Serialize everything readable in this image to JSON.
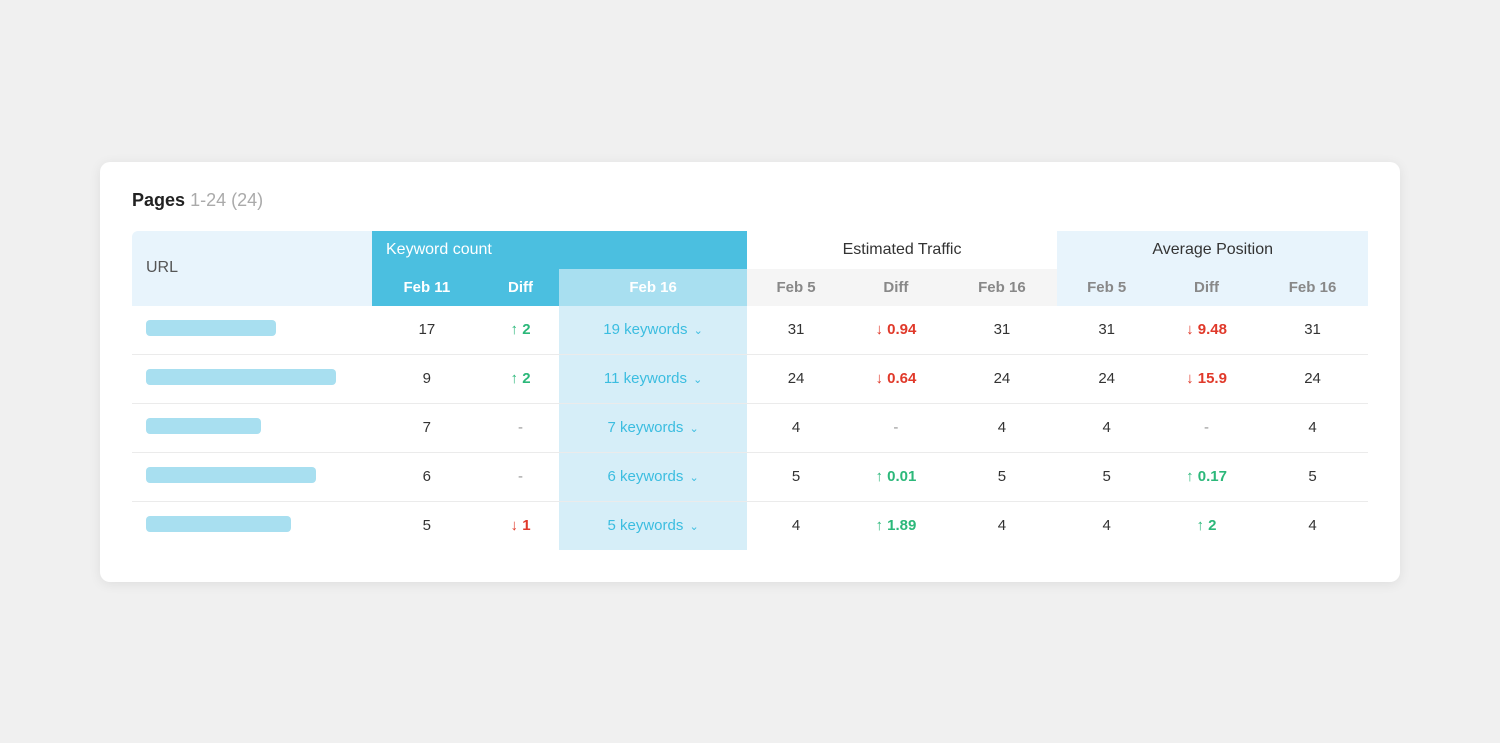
{
  "title": {
    "label": "Pages",
    "range": "1-24",
    "count": "(24)"
  },
  "columns": {
    "url": "URL",
    "keyword_count": "Keyword count",
    "estimated_traffic": "Estimated Traffic",
    "average_position": "Average Position",
    "feb11": "Feb 11",
    "diff": "Diff",
    "feb16": "Feb 16",
    "feb5_traffic": "Feb 5",
    "diff_traffic": "Diff",
    "feb16_traffic": "Feb 16",
    "feb5_position": "Feb 5",
    "diff_position": "Diff",
    "feb16_position": "Feb 16"
  },
  "rows": [
    {
      "url_width": 130,
      "kw_old": "17",
      "kw_diff_dir": "up",
      "kw_diff_val": "2",
      "kw_new": "19 keywords",
      "traffic_old": "31",
      "traffic_diff_dir": "down",
      "traffic_diff_val": "0.94",
      "traffic_new": "31",
      "pos_old": "31",
      "pos_diff_dir": "down",
      "pos_diff_val": "9.48",
      "pos_new": "31"
    },
    {
      "url_width": 190,
      "kw_old": "9",
      "kw_diff_dir": "up",
      "kw_diff_val": "2",
      "kw_new": "11 keywords",
      "traffic_old": "24",
      "traffic_diff_dir": "down",
      "traffic_diff_val": "0.64",
      "traffic_new": "24",
      "pos_old": "24",
      "pos_diff_dir": "down",
      "pos_diff_val": "15.9",
      "pos_new": "24"
    },
    {
      "url_width": 115,
      "kw_old": "7",
      "kw_diff_dir": "none",
      "kw_diff_val": "-",
      "kw_new": "7 keywords",
      "traffic_old": "4",
      "traffic_diff_dir": "none",
      "traffic_diff_val": "-",
      "traffic_new": "4",
      "pos_old": "4",
      "pos_diff_dir": "none",
      "pos_diff_val": "-",
      "pos_new": "4"
    },
    {
      "url_width": 170,
      "kw_old": "6",
      "kw_diff_dir": "none",
      "kw_diff_val": "-",
      "kw_new": "6 keywords",
      "traffic_old": "5",
      "traffic_diff_dir": "up",
      "traffic_diff_val": "0.01",
      "traffic_new": "5",
      "pos_old": "5",
      "pos_diff_dir": "up",
      "pos_diff_val": "0.17",
      "pos_new": "5"
    },
    {
      "url_width": 145,
      "kw_old": "5",
      "kw_diff_dir": "down",
      "kw_diff_val": "1",
      "kw_new": "5 keywords",
      "traffic_old": "4",
      "traffic_diff_dir": "up",
      "traffic_diff_val": "1.89",
      "traffic_new": "4",
      "pos_old": "4",
      "pos_diff_dir": "up",
      "pos_diff_val": "2",
      "pos_new": "4"
    }
  ]
}
